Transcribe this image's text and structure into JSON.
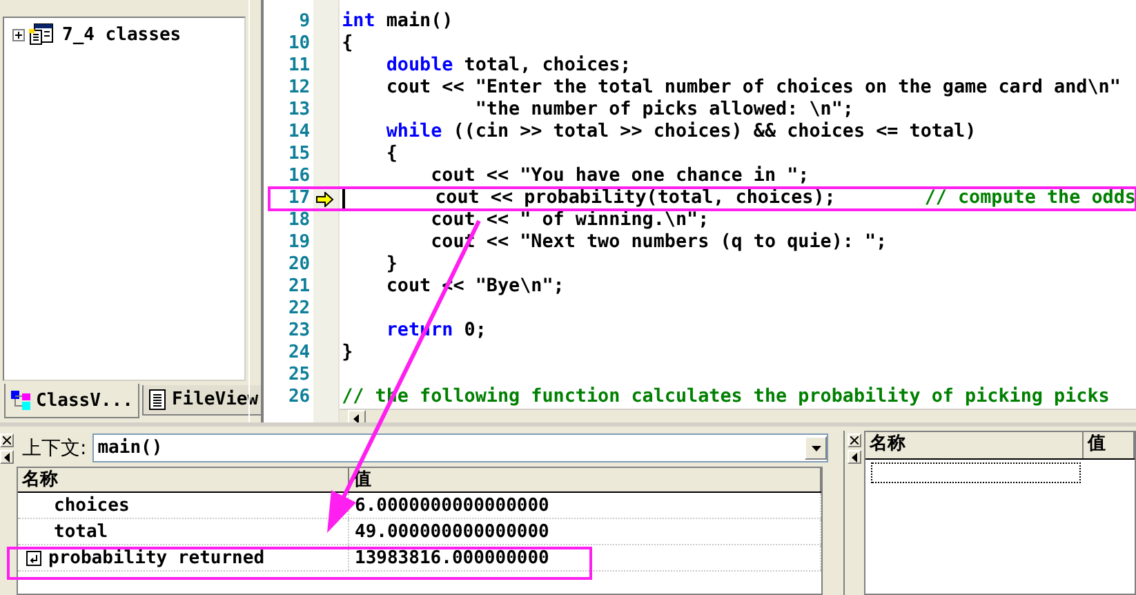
{
  "workspace": {
    "tree": [
      {
        "label": "7_4 classes",
        "expanded": false
      }
    ],
    "tabs": [
      {
        "label": "ClassV...",
        "selected": true
      },
      {
        "label": "FileView",
        "selected": false
      }
    ]
  },
  "editor": {
    "lines": [
      {
        "number": "9",
        "current": false,
        "highlighted": false,
        "tokens": [
          {
            "kind": "keyword",
            "text": "int"
          },
          {
            "kind": "plain",
            "text": " main()"
          }
        ]
      },
      {
        "number": "10",
        "current": false,
        "highlighted": false,
        "tokens": [
          {
            "kind": "plain",
            "text": "{"
          }
        ]
      },
      {
        "number": "11",
        "current": false,
        "highlighted": false,
        "tokens": [
          {
            "kind": "keyword",
            "text": "    double"
          },
          {
            "kind": "plain",
            "text": " total, choices;"
          }
        ]
      },
      {
        "number": "12",
        "current": false,
        "highlighted": false,
        "tokens": [
          {
            "kind": "plain",
            "text": "    cout << \"Enter the total number of choices on the game card and\\n\""
          }
        ]
      },
      {
        "number": "13",
        "current": false,
        "highlighted": false,
        "tokens": [
          {
            "kind": "plain",
            "text": "            \"the number of picks allowed: \\n\";"
          }
        ]
      },
      {
        "number": "14",
        "current": false,
        "highlighted": false,
        "tokens": [
          {
            "kind": "keyword",
            "text": "    while"
          },
          {
            "kind": "plain",
            "text": " ((cin >> total >> choices) && choices <= total)"
          }
        ]
      },
      {
        "number": "15",
        "current": false,
        "highlighted": false,
        "tokens": [
          {
            "kind": "plain",
            "text": "    {"
          }
        ]
      },
      {
        "number": "16",
        "current": false,
        "highlighted": false,
        "tokens": [
          {
            "kind": "plain",
            "text": "        cout << \"You have one chance in \";"
          }
        ]
      },
      {
        "number": "17",
        "current": true,
        "highlighted": true,
        "tokens": [
          {
            "kind": "plain",
            "text": "        cout << probability(total, choices);        "
          },
          {
            "kind": "comment",
            "text": "// compute the odds"
          }
        ]
      },
      {
        "number": "18",
        "current": false,
        "highlighted": false,
        "tokens": [
          {
            "kind": "plain",
            "text": "        cout << \" of winning.\\n\";"
          }
        ]
      },
      {
        "number": "19",
        "current": false,
        "highlighted": false,
        "tokens": [
          {
            "kind": "plain",
            "text": "        cout << \"Next two numbers (q to quie): \";"
          }
        ]
      },
      {
        "number": "20",
        "current": false,
        "highlighted": false,
        "tokens": [
          {
            "kind": "plain",
            "text": "    }"
          }
        ]
      },
      {
        "number": "21",
        "current": false,
        "highlighted": false,
        "tokens": [
          {
            "kind": "plain",
            "text": "    cout << \"Bye\\n\";"
          }
        ]
      },
      {
        "number": "22",
        "current": false,
        "highlighted": false
      },
      {
        "number": "23",
        "current": false,
        "highlighted": false,
        "tokens": [
          {
            "kind": "keyword",
            "text": "    return"
          },
          {
            "kind": "plain",
            "text": " 0;"
          }
        ]
      },
      {
        "number": "24",
        "current": false,
        "highlighted": false,
        "tokens": [
          {
            "kind": "plain",
            "text": "}"
          }
        ]
      },
      {
        "number": "25",
        "current": false,
        "highlighted": false
      },
      {
        "number": "26",
        "current": false,
        "highlighted": false,
        "tokens": [
          {
            "kind": "comment",
            "text": "// the following function calculates the probability of picking picks"
          }
        ]
      }
    ]
  },
  "variables": {
    "context_label": "上下文:",
    "context_value": "main()",
    "columns": [
      "名称",
      "值"
    ],
    "rows": [
      {
        "kind": "variable",
        "name": "choices",
        "value": "6.0000000000000000",
        "highlighted": false
      },
      {
        "kind": "variable",
        "name": "total",
        "value": "49.000000000000000",
        "highlighted": false
      },
      {
        "kind": "return",
        "name": "probability returned",
        "value": "13983816.000000000",
        "highlighted": true
      }
    ]
  },
  "watch": {
    "columns": [
      "名称",
      "值"
    ]
  }
}
